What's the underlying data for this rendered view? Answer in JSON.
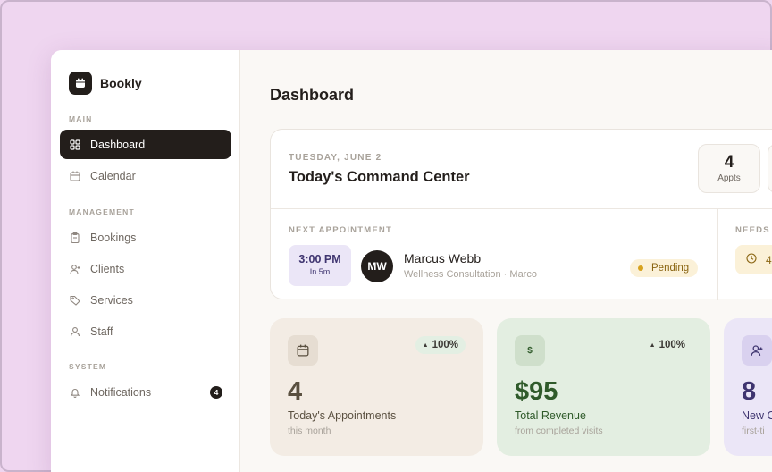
{
  "brand": {
    "name": "Bookly"
  },
  "sidebar": {
    "sections": [
      {
        "label": "MAIN"
      },
      {
        "label": "MANAGEMENT"
      },
      {
        "label": "SYSTEM"
      }
    ],
    "items": [
      {
        "label": "Dashboard",
        "icon": "grid-icon",
        "active": true
      },
      {
        "label": "Calendar",
        "icon": "calendar-icon"
      },
      {
        "label": "Bookings",
        "icon": "clipboard-icon"
      },
      {
        "label": "Clients",
        "icon": "user-plus-icon"
      },
      {
        "label": "Services",
        "icon": "tag-icon"
      },
      {
        "label": "Staff",
        "icon": "user-icon"
      },
      {
        "label": "Notifications",
        "icon": "bell-icon",
        "badge": "4"
      }
    ]
  },
  "main": {
    "title": "Dashboard",
    "command": {
      "date": "TUESDAY, JUNE 2",
      "title": "Today's Command Center",
      "stats": [
        {
          "value": "4",
          "caption": "Appts"
        }
      ],
      "next_label": "NEXT APPOINTMENT",
      "needs_label": "NEEDS",
      "appointment": {
        "time": "3:00 PM",
        "eta": "In 5m",
        "initials": "MW",
        "client": "Marcus Webb",
        "detail": "Wellness Consultation · Marco",
        "status": "Pending"
      },
      "needs_value": "4"
    },
    "metrics": [
      {
        "value": "4",
        "label": "Today's Appointments",
        "sub": "this month",
        "trend": "100%",
        "icon": "calendar-icon",
        "bg": "#f3ece4",
        "icon_bg": "#e6ddd2",
        "value_color": "#5a5040",
        "trend_bg": "#e3efe3"
      },
      {
        "value": "$95",
        "label": "Total Revenue",
        "sub": "from completed visits",
        "trend": "100%",
        "icon": "dollar-icon",
        "bg": "#e3eee1",
        "icon_bg": "#cfdfcb",
        "value_color": "#2f5a2a",
        "trend_bg": "#e3eee1"
      },
      {
        "value": "8",
        "label": "New C",
        "sub": "first-ti",
        "icon": "user-plus-icon",
        "bg": "#ebe6f7",
        "icon_bg": "#d9d1ef",
        "value_color": "#3f3570"
      }
    ]
  },
  "colors": {
    "accent_dark": "#231e1b",
    "pending": "#d7a21d",
    "lavender_bg": "#efd6f0"
  }
}
